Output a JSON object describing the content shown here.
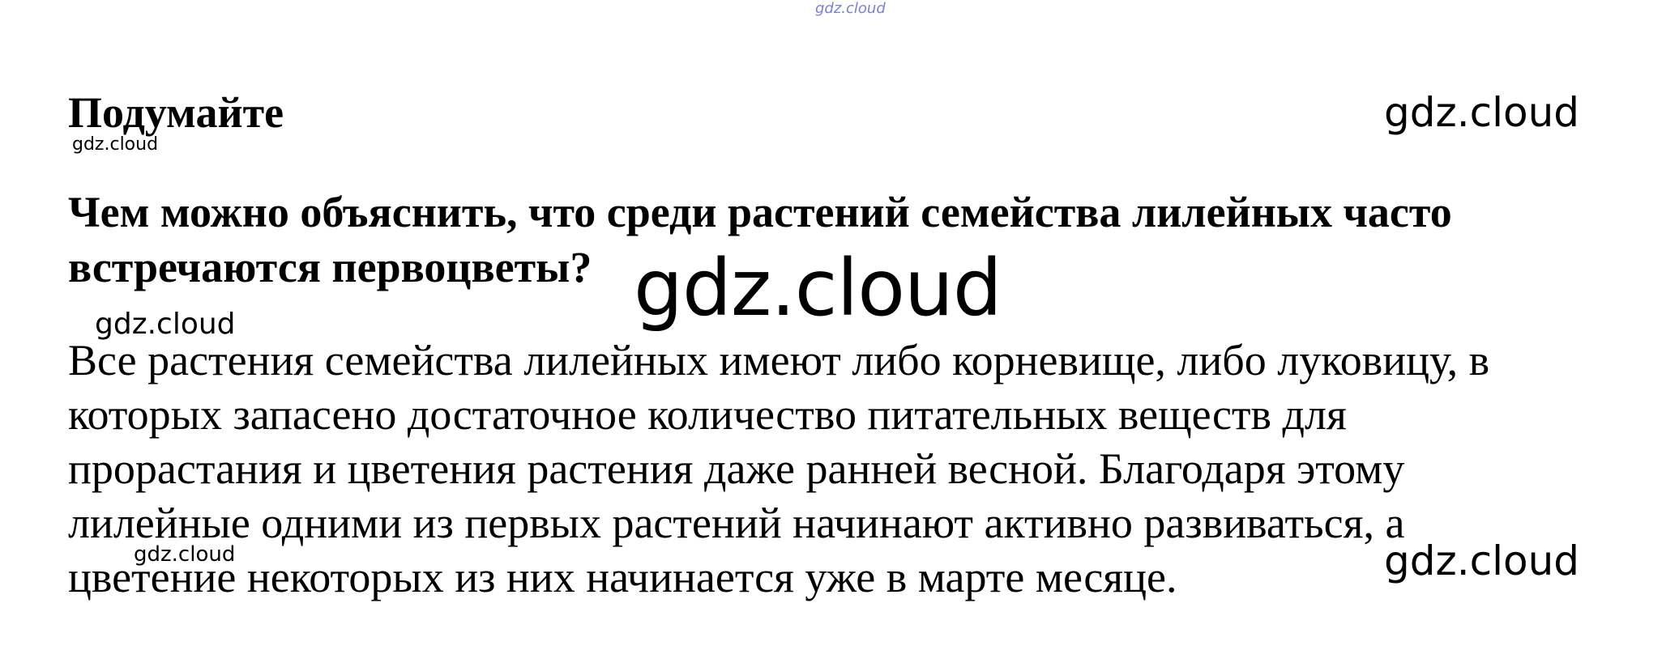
{
  "watermarks": {
    "top": "gdz.cloud",
    "heading_small": "gdz.cloud",
    "heading_right": "gdz.cloud",
    "center_big": "gdz.cloud",
    "mid_left": "gdz.cloud",
    "bottom_left": "gdz.cloud",
    "bottom_right": "gdz.cloud"
  },
  "heading": "Подумайте",
  "question": {
    "lines": [
      "Чем можно объяснить, что среди растений семейства лилейных часто",
      "встречаются первоцветы?"
    ]
  },
  "answer": {
    "lines": [
      "Все растения семейства лилейных имеют либо корневище, либо луковицу, в",
      "которых запасено достаточное количество питательных веществ для",
      "прорастания и цветения растения даже ранней весной. Благодаря этому",
      "лилейные одними из первых растений начинают активно развиваться, а",
      "цветение некоторых из них начинается уже в марте месяце."
    ]
  }
}
